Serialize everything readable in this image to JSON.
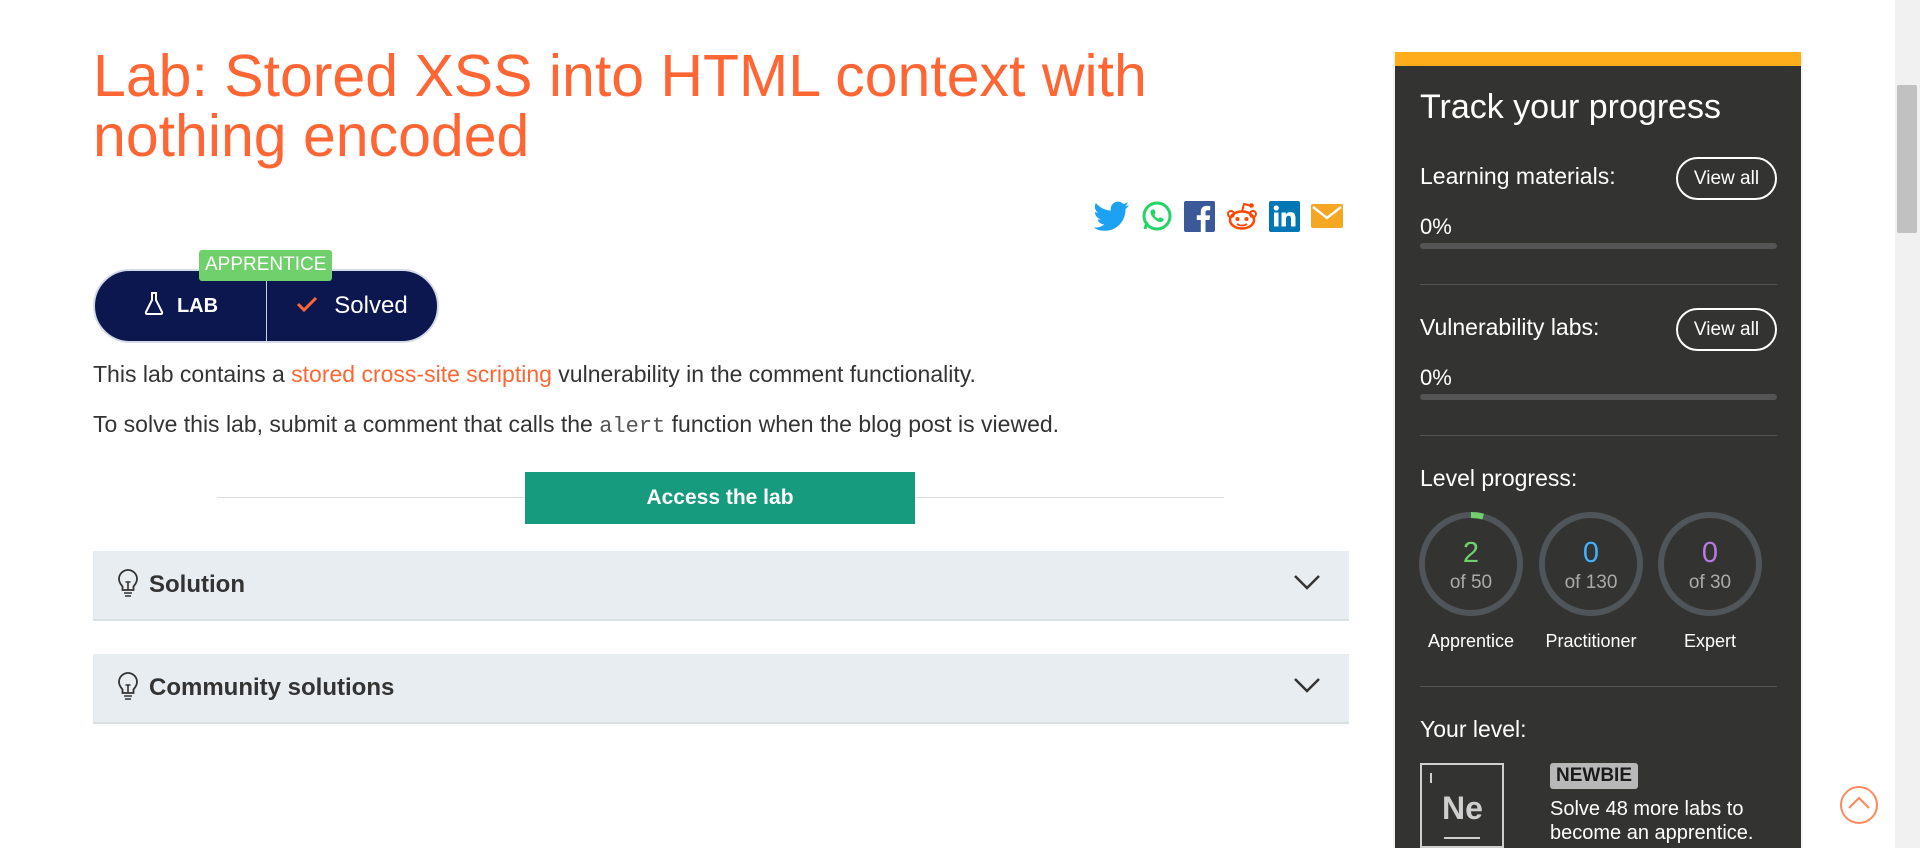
{
  "lab": {
    "title": "Lab: Stored XSS into HTML context with nothing encoded",
    "level_tag": "APPRENTICE",
    "lab_label": "LAB",
    "status_label": "Solved",
    "description_pre": "This lab contains a ",
    "description_link": "stored cross-site scripting",
    "description_post": " vulnerability in the comment functionality.",
    "instruction_pre": "To solve this lab, submit a comment that calls the ",
    "instruction_code": "alert",
    "instruction_post": " function when the blog post is viewed.",
    "access_button": "Access the lab"
  },
  "share": {
    "icons": [
      "twitter-icon",
      "whatsapp-icon",
      "facebook-icon",
      "reddit-icon",
      "linkedin-icon",
      "email-icon"
    ]
  },
  "accordions": [
    {
      "label": "Solution"
    },
    {
      "label": "Community solutions"
    }
  ],
  "progress": {
    "title": "Track your progress",
    "learning_label": "Learning materials:",
    "learning_view_all": "View all",
    "learning_pct": "0%",
    "learning_fraction": 0,
    "vuln_label": "Vulnerability labs:",
    "vuln_view_all": "View all",
    "vuln_pct": "0%",
    "vuln_fraction": 0,
    "level_progress_label": "Level progress:",
    "levels": [
      {
        "count": "2",
        "of": "of 50",
        "name": "Apprentice",
        "color": "#70d16c",
        "fraction": 0.04
      },
      {
        "count": "0",
        "of": "of 130",
        "name": "Practitioner",
        "color": "#3fb2ff",
        "fraction": 0
      },
      {
        "count": "0",
        "of": "of 30",
        "name": "Expert",
        "color": "#b57be0",
        "fraction": 0
      }
    ],
    "your_level_label": "Your level:",
    "level_symbol": "Ne",
    "level_name": "NEWBIE",
    "level_message": "Solve 48 more labs to become an apprentice."
  },
  "colors": {
    "accent": "#ff6633",
    "panel_bg": "#333332",
    "panel_top": "#ffad1a",
    "button_green": "#179b7e",
    "badge_navy": "#0c164f"
  }
}
